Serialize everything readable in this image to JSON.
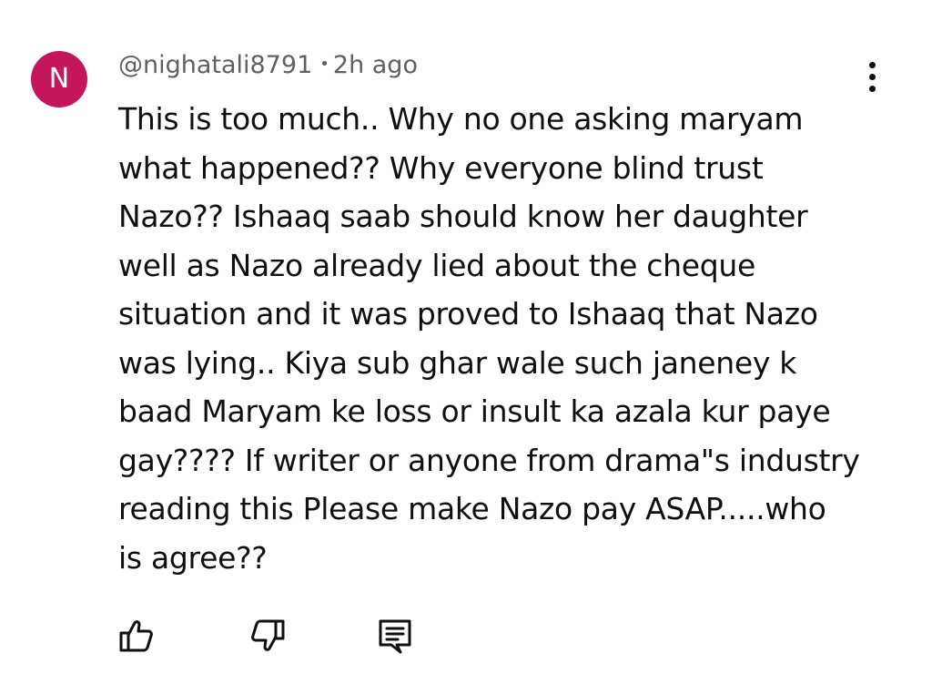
{
  "comment": {
    "avatar_letter": "N",
    "avatar_color": "#c2185b",
    "author": "@nighatali8791",
    "separator": "•",
    "timestamp": "2h ago",
    "text": "This is too much.. Why no one asking maryam\nwhat happened?? Why everyone blind trust\nNazo?? Ishaaq saab should know her daughter\nwell as Nazo already lied about the cheque\nsituation and it was proved to Ishaaq that Nazo\nwas lying.. Kiya sub ghar wale such janeney k\nbaad Maryam ke loss or insult ka azala kur paye\ngay???? If writer or anyone from drama\"s industry\nreading this Please make Nazo pay ASAP.....who\nis agree??"
  },
  "menu_icon": "more-vert-icon",
  "actions": {
    "like_icon": "thumb-up-icon",
    "dislike_icon": "thumb-down-icon",
    "reply_icon": "comment-reply-icon"
  }
}
